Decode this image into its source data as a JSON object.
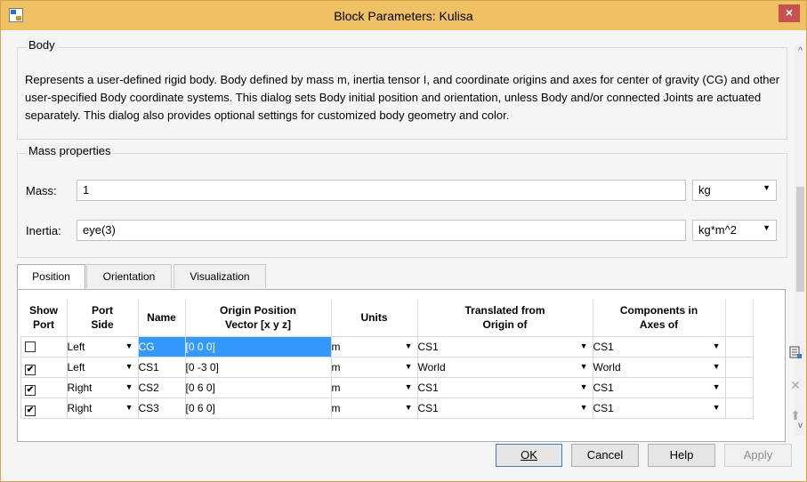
{
  "window": {
    "title": "Block Parameters: Kulisa",
    "close_label": "×"
  },
  "body_group": {
    "title": "Body",
    "description": "Represents a user-defined rigid body. Body defined by mass m, inertia tensor I, and coordinate origins and axes for center of gravity (CG) and other user-specified Body coordinate systems. This dialog sets Body initial position and orientation, unless Body and/or connected Joints are actuated separately. This dialog also provides optional settings for customized body geometry and color."
  },
  "mass_props": {
    "title": "Mass properties",
    "mass_label": "Mass:",
    "mass_value": "1",
    "mass_unit": "kg",
    "inertia_label": "Inertia:",
    "inertia_value": "eye(3)",
    "inertia_unit": "kg*m^2"
  },
  "tabs": [
    "Position",
    "Orientation",
    "Visualization"
  ],
  "table": {
    "headers": [
      "Show\nPort",
      "Port\nSide",
      "Name",
      "Origin Position\nVector [x y z]",
      "Units",
      "Translated from\nOrigin of",
      "Components in\nAxes of"
    ],
    "rows": [
      {
        "show": "",
        "side": "Left",
        "name": "CG",
        "origin": "[0 0 0]",
        "units": "m",
        "translated": "CS1",
        "axes": "CS1"
      },
      {
        "show": "✔",
        "side": "Left",
        "name": "CS1",
        "origin": "[0 -3 0]",
        "units": "m",
        "translated": "World",
        "axes": "World"
      },
      {
        "show": "✔",
        "side": "Right",
        "name": "CS2",
        "origin": "[0 6 0]",
        "units": "m",
        "translated": "CS1",
        "axes": "CS1"
      },
      {
        "show": "✔",
        "side": "Right",
        "name": "CS3",
        "origin": "[0 6 0]",
        "units": "m",
        "translated": "CS1",
        "axes": "CS1"
      }
    ]
  },
  "buttons": {
    "ok": "OK",
    "cancel": "Cancel",
    "help": "Help",
    "apply": "Apply"
  },
  "icons": {
    "scroll_up": "^",
    "scroll_down": "v",
    "add_port": "add-port-icon",
    "delete_port": "delete-port-icon",
    "move_up": "move-up-icon"
  }
}
